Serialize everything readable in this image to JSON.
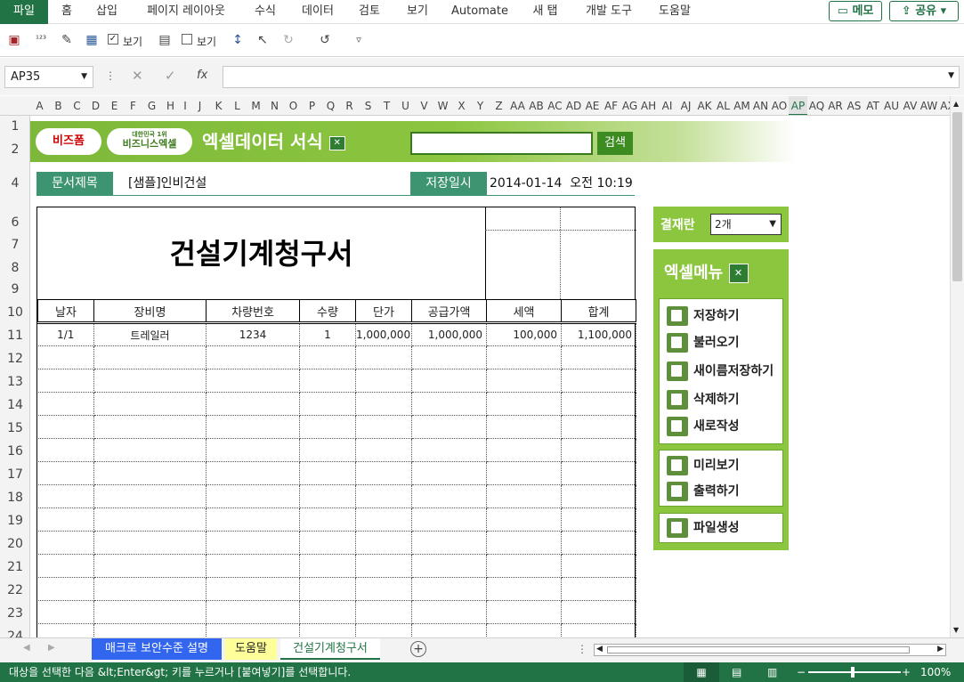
{
  "ribbon": {
    "tabs": [
      "파일",
      "홈",
      "삽입",
      "페이지 레이아웃",
      "수식",
      "데이터",
      "검토",
      "보기",
      "Automate",
      "새 탭",
      "개발 도구",
      "도움말"
    ],
    "memo_label": "메모",
    "share_label": "공유"
  },
  "qat": {
    "show1": "보기",
    "show2": "보기"
  },
  "formula_bar": {
    "name_box": "AP35",
    "fx": "fx"
  },
  "columns": [
    "A",
    "B",
    "C",
    "D",
    "E",
    "F",
    "G",
    "H",
    "I",
    "J",
    "K",
    "L",
    "M",
    "N",
    "O",
    "P",
    "Q",
    "R",
    "S",
    "T",
    "U",
    "V",
    "W",
    "X",
    "Y",
    "Z",
    "AA",
    "AB",
    "AC",
    "AD",
    "AE",
    "AF",
    "AG",
    "AH",
    "AI",
    "AJ",
    "AK",
    "AL",
    "AM",
    "AN",
    "AO",
    "AP",
    "AQ",
    "AR",
    "AS",
    "AT",
    "AU",
    "AV",
    "AW",
    "AX"
  ],
  "selected_column": "AP",
  "rows": [
    "1",
    "2",
    "4",
    "6",
    "7",
    "8",
    "9",
    "10",
    "11",
    "12",
    "13",
    "14",
    "15",
    "16",
    "17",
    "18",
    "19",
    "20",
    "21",
    "22",
    "23",
    "24"
  ],
  "banner": {
    "logo1": "비즈폼",
    "logo2_small": "대한민국 1위",
    "logo2": "비즈니스엑셀",
    "title": "엑셀데이터 서식",
    "search_button": "검색"
  },
  "header": {
    "doc_title_label": "문서제목",
    "doc_title_value": "[샘플]인비건설",
    "saved_label": "저장일시",
    "saved_value": "2014-01-14  오전 10:19"
  },
  "form": {
    "title": "건설기계청구서",
    "columns": [
      "날자",
      "장비명",
      "차량번호",
      "수량",
      "단가",
      "공급가액",
      "세액",
      "합계"
    ],
    "rows": [
      [
        "1/1",
        "트레일러",
        "1234",
        "1",
        "1,000,000",
        "1,000,000",
        "100,000",
        "1,100,000"
      ]
    ]
  },
  "approval": {
    "label": "결재란",
    "value": "2개"
  },
  "menu": {
    "title": "엑셀메뉴",
    "group1": [
      "저장하기",
      "불러오기",
      "새이름저장하기",
      "삭제하기",
      "새로작성"
    ],
    "group2": [
      "미리보기",
      "출력하기"
    ],
    "group3": [
      "파일생성"
    ]
  },
  "sheet_tabs": [
    "매크로 보안수준 설명",
    "도움말",
    "건설기계청구서"
  ],
  "status": {
    "message": "대상을 선택한 다음 &lt;Enter&gt; 키를 누르거나 [붙여넣기]를 선택합니다.",
    "zoom": "100%"
  }
}
